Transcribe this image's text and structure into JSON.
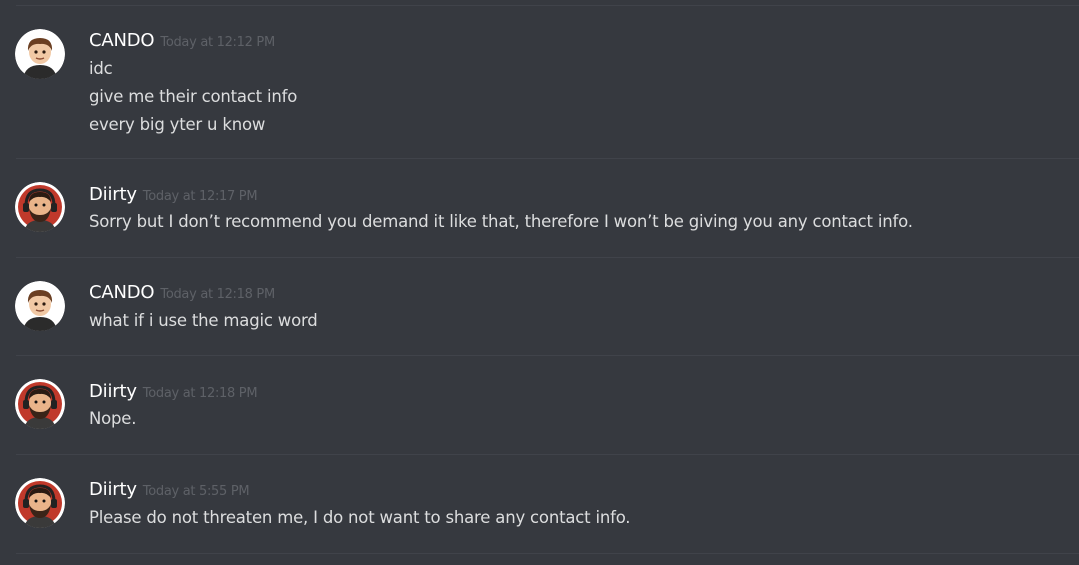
{
  "messages": [
    {
      "author": "CANDO",
      "avatar_icon": "cartoon-boy-avatar-icon",
      "timestamp": "Today at 12:12 PM",
      "lines": [
        "idc",
        "give me their contact info",
        "every big yter u know"
      ]
    },
    {
      "author": "Diirty",
      "avatar_icon": "bearded-man-headset-avatar-icon",
      "timestamp": "Today at 12:17 PM",
      "lines": [
        "Sorry but I don’t recommend you demand it like that, therefore I won’t be giving you any contact info."
      ]
    },
    {
      "author": "CANDO",
      "avatar_icon": "cartoon-boy-avatar-icon",
      "timestamp": "Today at 12:18 PM",
      "lines": [
        "what if i use the magic word"
      ]
    },
    {
      "author": "Diirty",
      "avatar_icon": "bearded-man-headset-avatar-icon",
      "timestamp": "Today at 12:18 PM",
      "lines": [
        "Nope."
      ]
    },
    {
      "author": "Diirty",
      "avatar_icon": "bearded-man-headset-avatar-icon",
      "timestamp": "Today at 5:55 PM",
      "lines": [
        "Please do not threaten me, I do not want to share any contact info."
      ]
    }
  ],
  "colors": {
    "background": "#36393f",
    "divider": "#40434a",
    "username": "#ffffff",
    "timestamp": "#5e6167",
    "message_text": "#dcddde"
  }
}
